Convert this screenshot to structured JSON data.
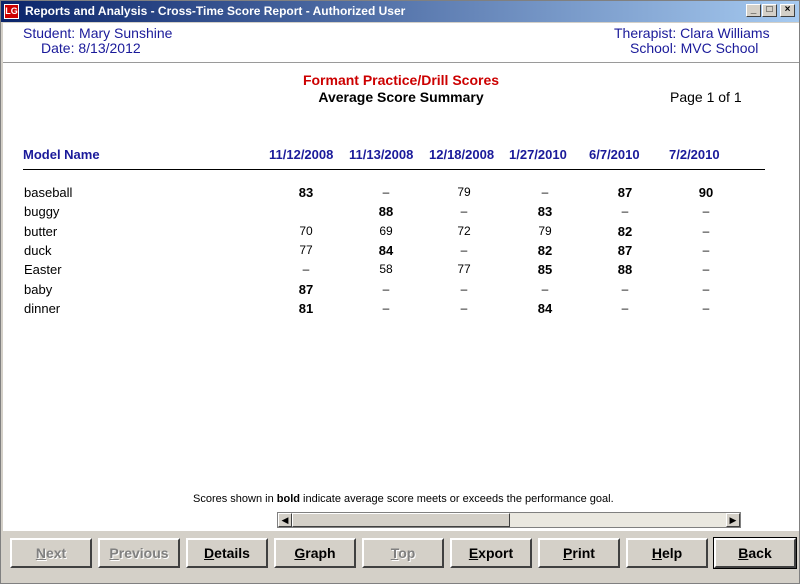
{
  "window": {
    "title": "Reports and Analysis - Cross-Time Score Report  - Authorized User",
    "app_icon": "LG",
    "controls": {
      "minimize": "_",
      "maximize": "□",
      "close": "×"
    }
  },
  "header": {
    "student_label": "Student:",
    "student_value": "Mary Sunshine",
    "date_label": "Date:",
    "date_value": "8/13/2012",
    "therapist_label": "Therapist:",
    "therapist_value": "Clara Williams",
    "school_label": "School:",
    "school_value": "MVC School"
  },
  "report": {
    "title": "Formant Practice/Drill Scores",
    "subtitle": "Average Score Summary",
    "page_info": "Page  1  of  1",
    "model_name_header": "Model Name",
    "columns": [
      "11/12/2008",
      "11/13/2008",
      "12/18/2008",
      "1/27/2010",
      "6/7/2010",
      "7/2/2010"
    ],
    "rows": [
      {
        "name": "baseball",
        "cells": [
          {
            "v": "83",
            "b": true
          },
          {
            "v": "–",
            "b": false
          },
          {
            "v": "79",
            "b": false
          },
          {
            "v": "–",
            "b": false
          },
          {
            "v": "87",
            "b": true
          },
          {
            "v": "90",
            "b": true
          }
        ]
      },
      {
        "name": "buggy",
        "cells": [
          {
            "v": "",
            "b": false
          },
          {
            "v": "88",
            "b": true
          },
          {
            "v": "–",
            "b": false
          },
          {
            "v": "83",
            "b": true
          },
          {
            "v": "–",
            "b": false
          },
          {
            "v": "–",
            "b": false
          }
        ]
      },
      {
        "name": "butter",
        "cells": [
          {
            "v": "70",
            "b": false
          },
          {
            "v": "69",
            "b": false
          },
          {
            "v": "72",
            "b": false
          },
          {
            "v": "79",
            "b": false
          },
          {
            "v": "82",
            "b": true
          },
          {
            "v": "–",
            "b": false
          }
        ]
      },
      {
        "name": "duck",
        "cells": [
          {
            "v": "77",
            "b": false
          },
          {
            "v": "84",
            "b": true
          },
          {
            "v": "–",
            "b": false
          },
          {
            "v": "82",
            "b": true
          },
          {
            "v": "87",
            "b": true
          },
          {
            "v": "–",
            "b": false
          }
        ]
      },
      {
        "name": "Easter",
        "cells": [
          {
            "v": "–",
            "b": false
          },
          {
            "v": "58",
            "b": false
          },
          {
            "v": "77",
            "b": false
          },
          {
            "v": "85",
            "b": true
          },
          {
            "v": "88",
            "b": true
          },
          {
            "v": "–",
            "b": false
          }
        ]
      },
      {
        "name": "baby",
        "cells": [
          {
            "v": "87",
            "b": true
          },
          {
            "v": "–",
            "b": false
          },
          {
            "v": "–",
            "b": false
          },
          {
            "v": "–",
            "b": false
          },
          {
            "v": "–",
            "b": false
          },
          {
            "v": "–",
            "b": false
          }
        ]
      },
      {
        "name": "dinner",
        "cells": [
          {
            "v": "81",
            "b": true
          },
          {
            "v": "–",
            "b": false
          },
          {
            "v": "–",
            "b": false
          },
          {
            "v": "84",
            "b": true
          },
          {
            "v": "–",
            "b": false
          },
          {
            "v": "–",
            "b": false
          }
        ]
      }
    ],
    "footnote_pre": "Scores shown in ",
    "footnote_bold": "bold",
    "footnote_post": " indicate average score meets or exceeds the performance goal."
  },
  "scrollbar": {
    "left_arrow": "◀",
    "right_arrow": "▶"
  },
  "buttons": [
    {
      "label": "Next",
      "underline": "N",
      "rest": "ext",
      "disabled": true,
      "name": "next-button"
    },
    {
      "label": "Previous",
      "underline": "P",
      "rest": "revious",
      "disabled": true,
      "name": "previous-button"
    },
    {
      "label": "Details",
      "underline": "D",
      "rest": "etails",
      "disabled": false,
      "name": "details-button"
    },
    {
      "label": "Graph",
      "underline": "G",
      "rest": "raph",
      "disabled": false,
      "name": "graph-button"
    },
    {
      "label": "Top",
      "underline": "T",
      "rest": "op",
      "disabled": true,
      "name": "top-button"
    },
    {
      "label": "Export",
      "underline": "E",
      "rest": "xport",
      "disabled": false,
      "name": "export-button"
    },
    {
      "label": "Print",
      "underline": "P",
      "rest": "rint",
      "disabled": false,
      "name": "print-button"
    },
    {
      "label": "Help",
      "underline": "H",
      "rest": "elp",
      "disabled": false,
      "name": "help-button"
    },
    {
      "label": "Back",
      "underline": "B",
      "rest": "ack",
      "disabled": false,
      "default": true,
      "name": "back-button"
    }
  ]
}
